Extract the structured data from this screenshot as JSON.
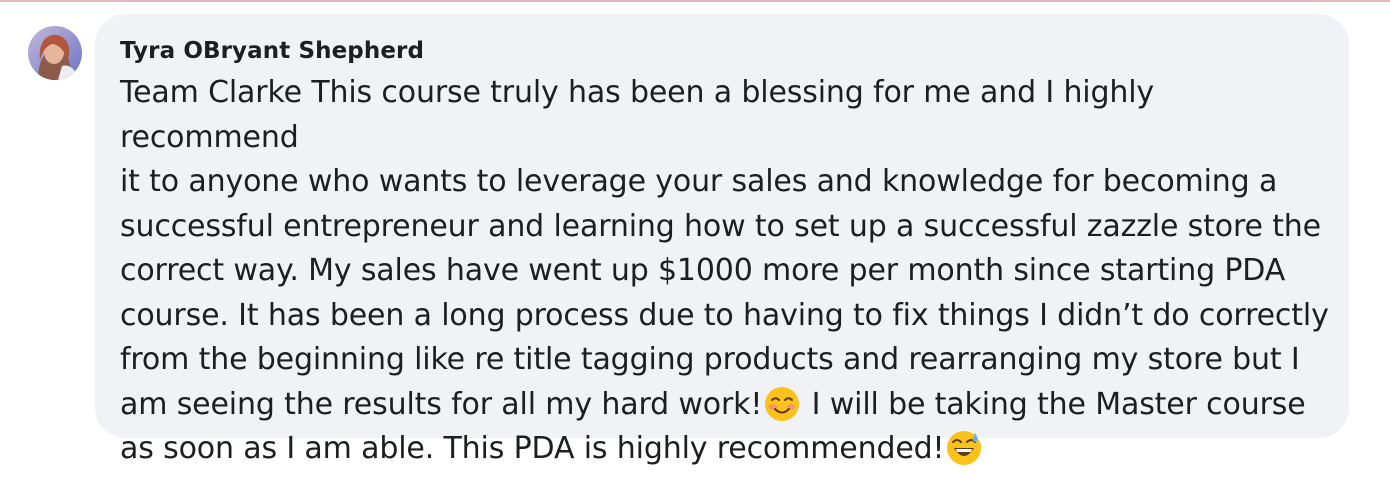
{
  "comment": {
    "author": "Tyra OBryant Shepherd",
    "text_part1": "Team Clarke This course truly has been a blessing for me and I highly recommend\nit to anyone who wants to leverage your sales and knowledge for becoming a\nsuccessful entrepreneur and learning how to set up a successful zazzle store the\ncorrect way. My sales have went up $1000 more per month since starting PDA\ncourse. It has been a long process due to having to fix things I didn’t do correctly\nfrom the beginning like re title tagging products and rearranging my store but I\nam seeing the results for all my hard work!",
    "emoji1": "smiling-face-with-blush-icon",
    "text_part2": " I will be taking the Master course\nas soon as I am able. This PDA is highly recommended!",
    "emoji2": "grinning-face-with-sweat-icon"
  },
  "colors": {
    "bubble": "#f0f2f5",
    "text": "#1c1e21",
    "top_rule": "#e7b7bd"
  }
}
